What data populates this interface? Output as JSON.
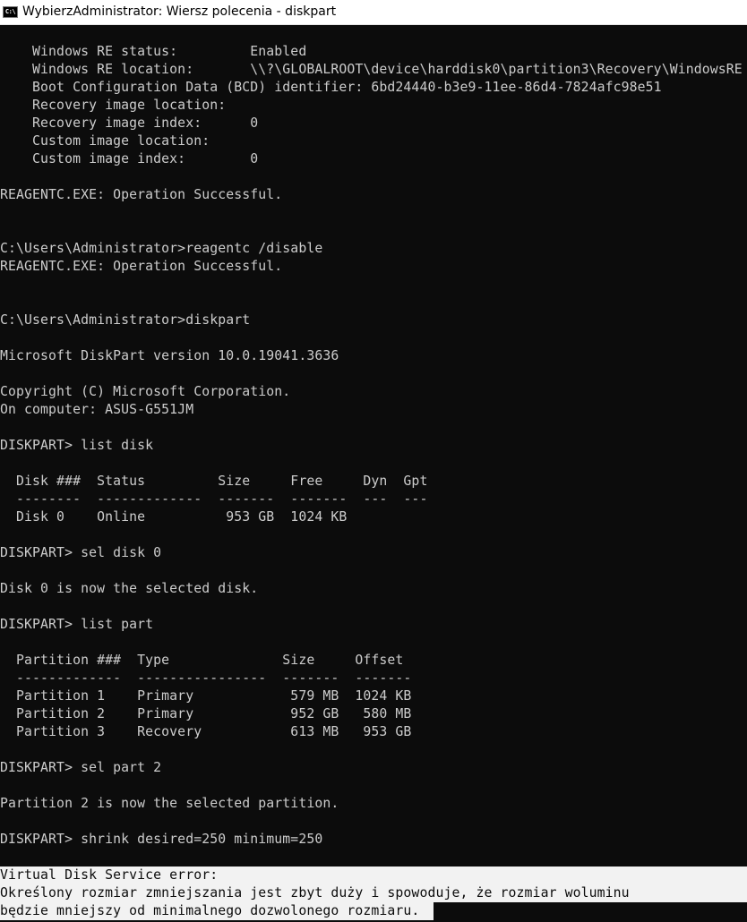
{
  "window": {
    "title": "WybierzAdministrator: Wiersz polecenia - diskpart",
    "icon": "command-prompt-icon",
    "icon_text": "C:\\",
    "background_color": "#0c0c0c",
    "text_color": "#cccccc",
    "selection_color": "#f2f2f2"
  },
  "console": {
    "lines": [
      "    Windows RE status:         Enabled",
      "    Windows RE location:       \\\\?\\GLOBALROOT\\device\\harddisk0\\partition3\\Recovery\\WindowsRE",
      "    Boot Configuration Data (BCD) identifier: 6bd24440-b3e9-11ee-86d4-7824afc98e51",
      "    Recovery image location:",
      "    Recovery image index:      0",
      "    Custom image location:",
      "    Custom image index:        0",
      "",
      "REAGENTC.EXE: Operation Successful.",
      "",
      "",
      "C:\\Users\\Administrator>reagentc /disable",
      "REAGENTC.EXE: Operation Successful.",
      "",
      "",
      "C:\\Users\\Administrator>diskpart",
      "",
      "Microsoft DiskPart version 10.0.19041.3636",
      "",
      "Copyright (C) Microsoft Corporation.",
      "On computer: ASUS-G551JM",
      "",
      "DISKPART> list disk",
      "",
      "  Disk ###  Status         Size     Free     Dyn  Gpt",
      "  --------  -------------  -------  -------  ---  ---",
      "  Disk 0    Online          953 GB  1024 KB",
      "",
      "DISKPART> sel disk 0",
      "",
      "Disk 0 is now the selected disk.",
      "",
      "DISKPART> list part",
      "",
      "  Partition ###  Type              Size     Offset",
      "  -------------  ----------------  -------  -------",
      "  Partition 1    Primary            579 MB  1024 KB",
      "  Partition 2    Primary            952 GB   580 MB",
      "  Partition 3    Recovery           613 MB   953 GB",
      "",
      "DISKPART> sel part 2",
      "",
      "Partition 2 is now the selected partition.",
      "",
      "DISKPART> shrink desired=250 minimum=250",
      ""
    ],
    "selected_lines": [
      "Virtual Disk Service error:",
      "Określony rozmiar zmniejszania jest zbyt duży i spowoduje, że rozmiar woluminu",
      "będzie mniejszy od minimalnego dozwolonego rozmiaru."
    ]
  }
}
